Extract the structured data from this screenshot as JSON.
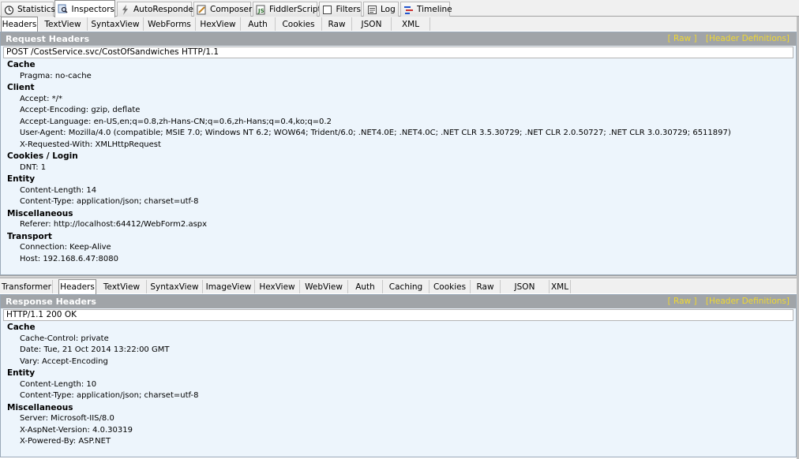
{
  "top_tabs": [
    {
      "label": "Statistics",
      "icon": "stopwatch-icon"
    },
    {
      "label": "Inspectors",
      "icon": "magnifier-icon"
    },
    {
      "label": "AutoResponder",
      "icon": "lightning-icon"
    },
    {
      "label": "Composer",
      "icon": "pencil-icon"
    },
    {
      "label": "FiddlerScript",
      "icon": "script-icon"
    },
    {
      "label": "Filters",
      "icon": "checkbox-icon"
    },
    {
      "label": "Log",
      "icon": "log-icon"
    },
    {
      "label": "Timeline",
      "icon": "timeline-icon"
    }
  ],
  "request_tabs": [
    "Headers",
    "TextView",
    "SyntaxView",
    "WebForms",
    "HexView",
    "Auth",
    "Cookies",
    "Raw",
    "JSON",
    "XML"
  ],
  "request": {
    "title": "Request Headers",
    "raw_link": "[ Raw ]",
    "defs_link": "[Header Definitions]",
    "request_line": "POST /CostService.svc/CostOfSandwiches HTTP/1.1",
    "groups": [
      {
        "name": "Cache",
        "items": [
          "Pragma: no-cache"
        ]
      },
      {
        "name": "Client",
        "items": [
          "Accept: */*",
          "Accept-Encoding: gzip, deflate",
          "Accept-Language: en-US,en;q=0.8,zh-Hans-CN;q=0.6,zh-Hans;q=0.4,ko;q=0.2",
          "User-Agent: Mozilla/4.0 (compatible; MSIE 7.0; Windows NT 6.2; WOW64; Trident/6.0; .NET4.0E; .NET4.0C; .NET CLR 3.5.30729; .NET CLR 2.0.50727; .NET CLR 3.0.30729; 6511897)",
          "X-Requested-With: XMLHttpRequest"
        ]
      },
      {
        "name": "Cookies / Login",
        "items": [
          "DNT: 1"
        ]
      },
      {
        "name": "Entity",
        "items": [
          "Content-Length: 14",
          "Content-Type: application/json; charset=utf-8"
        ]
      },
      {
        "name": "Miscellaneous",
        "items": [
          "Referer: http://localhost:64412/WebForm2.aspx"
        ]
      },
      {
        "name": "Transport",
        "items": [
          "Connection: Keep-Alive",
          "Host: 192.168.6.47:8080"
        ]
      }
    ]
  },
  "response_tabs": [
    "Transformer",
    "Headers",
    "TextView",
    "SyntaxView",
    "ImageView",
    "HexView",
    "WebView",
    "Auth",
    "Caching",
    "Cookies",
    "Raw",
    "JSON",
    "XML"
  ],
  "response": {
    "title": "Response Headers",
    "raw_link": "[ Raw ]",
    "defs_link": "[Header Definitions]",
    "status_line": "HTTP/1.1 200 OK",
    "groups": [
      {
        "name": "Cache",
        "items": [
          "Cache-Control: private",
          "Date: Tue, 21 Oct 2014 13:22:00 GMT",
          "Vary: Accept-Encoding"
        ]
      },
      {
        "name": "Entity",
        "items": [
          "Content-Length: 10",
          "Content-Type: application/json; charset=utf-8"
        ]
      },
      {
        "name": "Miscellaneous",
        "items": [
          "Server: Microsoft-IIS/8.0",
          "X-AspNet-Version: 4.0.30319",
          "X-Powered-By: ASP.NET"
        ]
      }
    ]
  }
}
